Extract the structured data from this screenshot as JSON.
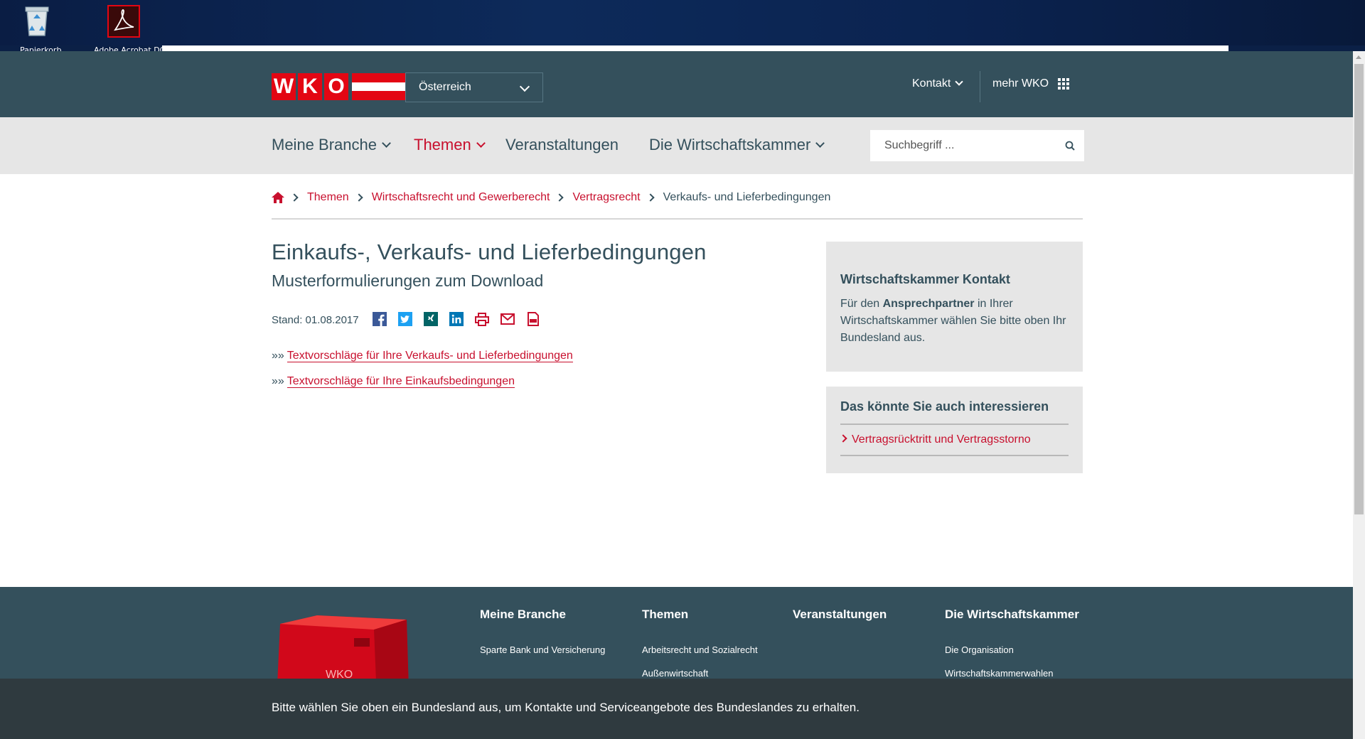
{
  "desktop": {
    "icons": [
      {
        "name": "recycle-bin",
        "label": "Papierkorb"
      },
      {
        "name": "adobe-acrobat",
        "label": "Adobe Acrobat DC"
      }
    ]
  },
  "header": {
    "logo_letters": [
      "W",
      "K",
      "O"
    ],
    "region_select": {
      "value": "Österreich"
    },
    "kontakt_label": "Kontakt",
    "mehr_label": "mehr WKO",
    "colors": {
      "topbar": "#34505c",
      "brand_red": "#e30613"
    }
  },
  "nav": {
    "items": [
      {
        "label": "Meine Branche",
        "has_dropdown": true,
        "active": false
      },
      {
        "label": "Themen",
        "has_dropdown": true,
        "active": true
      },
      {
        "label": "Veranstaltungen",
        "has_dropdown": false,
        "active": false
      },
      {
        "label": "Die Wirtschaftskammer",
        "has_dropdown": true,
        "active": false
      }
    ],
    "search": {
      "placeholder": "Suchbegriff ..."
    }
  },
  "breadcrumb": {
    "items": [
      {
        "label": "Themen",
        "link": true
      },
      {
        "label": "Wirtschaftsrecht und Gewerberecht",
        "link": true
      },
      {
        "label": "Vertragsrecht",
        "link": true
      },
      {
        "label": "Verkaufs- und Lieferbedingungen",
        "link": false
      }
    ]
  },
  "main": {
    "title": "Einkaufs-, Verkaufs- und Lieferbedingungen",
    "subtitle": "Musterformulierungen zum Download",
    "stand": "Stand: 01.08.2017",
    "share_icons": [
      "facebook-icon",
      "twitter-icon",
      "xing-icon",
      "linkedin-icon",
      "print-icon",
      "email-icon",
      "pdf-icon"
    ],
    "links": [
      {
        "prefix": "»»",
        "label": "Textvorschläge für Ihre Verkaufs- und Lieferbedingungen"
      },
      {
        "prefix": "»»",
        "label": "Textvorschläge für Ihre Einkaufsbedingungen"
      }
    ]
  },
  "sidebar": {
    "contact": {
      "title": "Wirtschaftskammer Kontakt",
      "text_before": "Für den ",
      "text_bold": "Ansprechpartner",
      "text_after": " in Ihrer Wirtschaftskammer wählen Sie bitte oben Ihr Bundesland aus."
    },
    "related": {
      "title": "Das könnte Sie auch interessieren",
      "links": [
        "Vertragsrücktritt und Vertragsstorno"
      ]
    }
  },
  "footer": {
    "columns": [
      {
        "title": "Meine Branche",
        "links": [
          "Sparte Bank und Versicherung"
        ]
      },
      {
        "title": "Themen",
        "links": [
          "Arbeitsrecht und Sozialrecht",
          "Außenwirtschaft"
        ]
      },
      {
        "title": "Veranstaltungen",
        "links": []
      },
      {
        "title": "Die Wirtschaftskammer",
        "links": [
          "Die Organisation",
          "Wirtschaftskammerwahlen"
        ]
      }
    ],
    "cube_label": "WKO"
  },
  "notice": {
    "text": "Bitte wählen Sie oben ein Bundesland aus, um Kontakte und Serviceangebote des Bundeslandes zu erhalten."
  }
}
